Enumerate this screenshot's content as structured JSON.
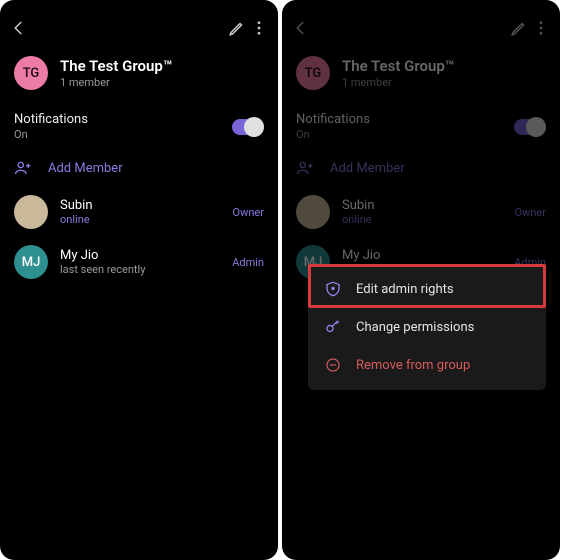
{
  "group": {
    "title": "The Test Group™",
    "subtitle": "1 member",
    "initials": "TG"
  },
  "notifications": {
    "label": "Notifications",
    "value": "On"
  },
  "addMember": "Add Member",
  "members": [
    {
      "name": "Subin",
      "status": "online",
      "role": "Owner",
      "avatarType": "img"
    },
    {
      "name": "My Jio",
      "status": "last seen recently",
      "role": "Admin",
      "initials": "MJ",
      "avatarType": "teal"
    }
  ],
  "contextMenu": {
    "edit": "Edit admin rights",
    "change": "Change permissions",
    "remove": "Remove from group"
  }
}
